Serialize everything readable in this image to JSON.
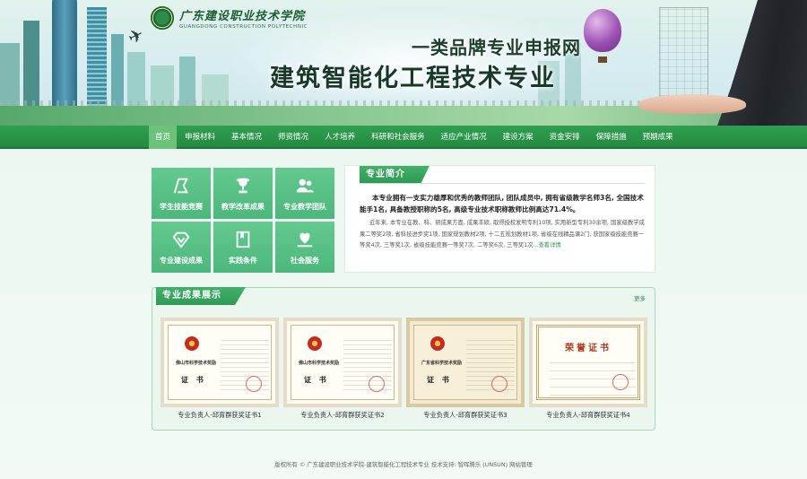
{
  "header": {
    "school_cn": "广东建设职业技术学院",
    "school_en": "GUANGDONG CONSTRUCTION POLYTECHNIC",
    "title_line1": "一类品牌专业申报网",
    "title_line2": "建筑智能化工程技术专业"
  },
  "nav": {
    "items": [
      "首页",
      "申报材料",
      "基本情况",
      "师资情况",
      "人才培养",
      "科研和社会服务",
      "适应产业情况",
      "建设方案",
      "资金安排",
      "保障措施",
      "预期成果"
    ],
    "active_index": 0
  },
  "tiles": [
    {
      "label": "学生技能竞赛",
      "icon": "flag-icon"
    },
    {
      "label": "教学改革成果",
      "icon": "trophy-icon"
    },
    {
      "label": "专业教学团队",
      "icon": "team-icon"
    },
    {
      "label": "专业建设成果",
      "icon": "diamond-icon"
    },
    {
      "label": "实践条件",
      "icon": "book-icon"
    },
    {
      "label": "社会服务",
      "icon": "heart-hand-icon"
    }
  ],
  "intro": {
    "heading": "专业简介",
    "paragraph1": "本专业拥有一支实力雄厚和优秀的教师团队, 团队成员中, 拥有省级教学名师3名, 全国技术能手1名, 具备教授职称的5名, 高级专业技术职称教师比例高达71.4%。",
    "paragraph2": "近年来, 本专业在教、科、研成果方面, 成果丰硕, 取得授权发明专利10项, 实用新型专利30余项, 国家级教学成果二等奖2项, 省科技进步奖1项, 国家规划教材2项, 十二五规划教材1项, 省级在线精品课2门, 获国家级技能竞赛一等奖4次, 三等奖1次, 省级技能竞赛一等奖7次, 二等奖6次, 三等奖1次",
    "more_label": "...查看详情"
  },
  "achievements": {
    "heading": "专业成果展示",
    "more_label": "更多",
    "items": [
      {
        "caption": "专业负责人-邱育群获奖证书1",
        "org": "佛山市科学技术奖励",
        "title": "证 书",
        "style": "plain"
      },
      {
        "caption": "专业负责人-邱育群获奖证书2",
        "org": "佛山市科学技术奖励",
        "title": "证 书",
        "style": "plain"
      },
      {
        "caption": "专业负责人-邱育群获奖证书3",
        "org": "广东省科学技术奖励",
        "title": "证 书",
        "style": "plain"
      },
      {
        "caption": "专业负责人-邱育群获奖证书4",
        "org": "",
        "title": "荣誉证书",
        "style": "honor"
      }
    ]
  },
  "footer": {
    "text": "版权所有 © 广东建设职业技术学院-建筑智能化工程技术专业 技术支持: 智晖腾乐 (UNSUN) 网站管理"
  },
  "colors": {
    "nav_green": "#2f9f4f",
    "nav_active": "#6cc17b",
    "tile_green": "#55bd83",
    "heading_green": "#3aa862"
  }
}
